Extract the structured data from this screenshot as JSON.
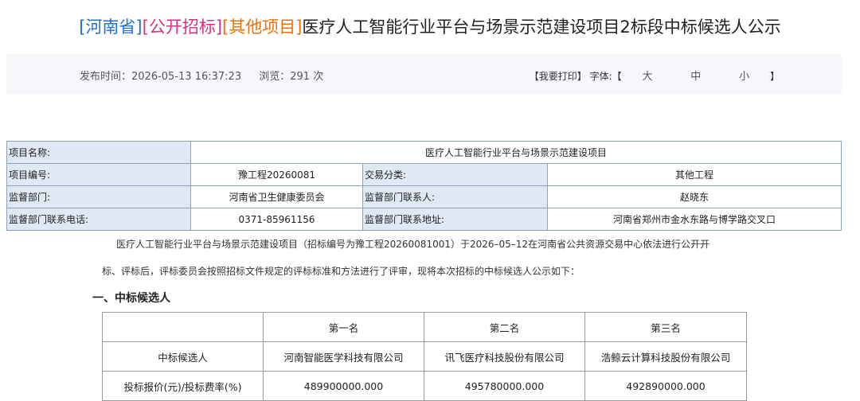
{
  "title": {
    "region": "[河南省]",
    "type": "[公开招标]",
    "category": "[其他项目]",
    "text": "医疗人工智能行业平台与场景示范建设项目2标段中标候选人公示"
  },
  "meta": {
    "publish_label": "发布时间：",
    "publish_time": "2026-05-13 16:37:23",
    "views_label": "浏览：",
    "views": "291",
    "views_unit": "次",
    "print_label": "【我要打印】",
    "font_label": "字体:【",
    "font_large": "大",
    "font_medium": "中",
    "font_small": "小",
    "font_close": "】"
  },
  "info": {
    "project_name_label": "项目名称:",
    "project_name": "医疗人工智能行业平台与场景示范建设项目",
    "project_no_label": "项目编号:",
    "project_no": "豫工程20260081",
    "trade_type_label": "交易分类:",
    "trade_type": "其他工程",
    "supervisor_label": "监督部门:",
    "supervisor": "河南省卫生健康委员会",
    "contact_label": "监督部门联系人:",
    "contact": "赵晓东",
    "phone_label": "监督部门联系电话:",
    "phone": "0371-85961156",
    "address_label": "监督部门联系地址:",
    "address": "河南省郑州市金水东路与博学路交叉口"
  },
  "body": {
    "para1": "医疗人工智能行业平台与场景示范建设项目（招标编号为豫工程20260081001）于2026–05–12在河南省公共资源交易中心依法进行公开开",
    "para2": "标、评标后，评标委员会按照招标文件规定的评标标准和方法进行了评审，现将本次招标的中标候选人公示如下：",
    "section1": "一、中标候选人"
  },
  "candidates": {
    "headers": [
      "",
      "第一名",
      "第二名",
      "第三名"
    ],
    "rows": [
      [
        "中标候选人",
        "河南智能医学科技有限公司",
        "讯飞医疗科技股份有限公司",
        "浩鲸云计算科技股份有限公司"
      ],
      [
        "投标报价(元)/投标费率(%)",
        "489900000.000",
        "495780000.000",
        "492890000.000"
      ]
    ]
  }
}
